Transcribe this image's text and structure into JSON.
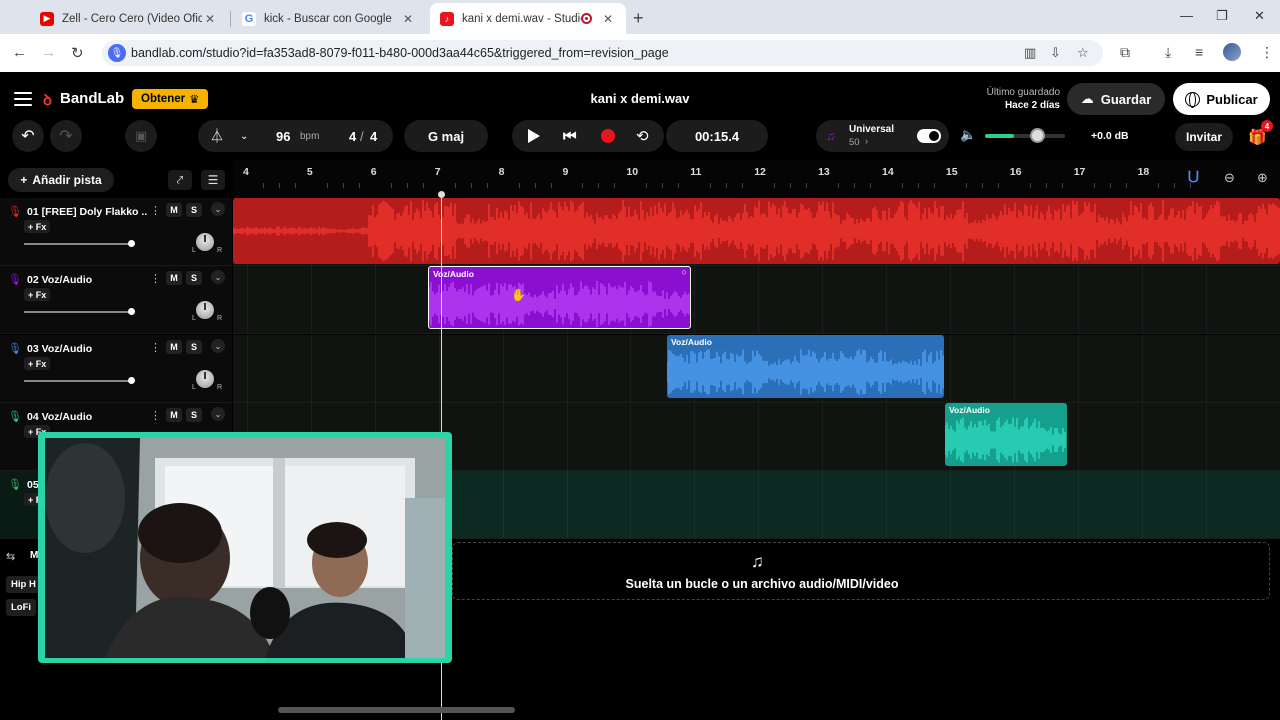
{
  "browser": {
    "tabs": [
      {
        "title": "Zell - Cero Cero (Video Oficial)"
      },
      {
        "title": "kick - Buscar con Google"
      },
      {
        "title": "kani x demi.wav - Studio"
      }
    ],
    "url": "bandlab.com/studio?id=fa353ad8-8079-f011-b480-000d3aa44c65&triggered_from=revision_page"
  },
  "app": {
    "brand": "BandLab",
    "obtener_label": "Obtener",
    "project_title": "kani x demi.wav",
    "last_saved_label": "Último guardado",
    "last_saved_value": "Hace 2 días",
    "save_label": "Guardar",
    "publish_label": "Publicar"
  },
  "transport": {
    "tempo": "96",
    "tempo_unit": "bpm",
    "time_sig_num": "4",
    "time_sig_den": "4",
    "key": "G maj",
    "time": "00:15.4",
    "tuner_label": "Universal",
    "tuner_value": "50",
    "volume_db": "+0.0 dB",
    "volume_level": 0.65,
    "invite_label": "Invitar",
    "notification_count": "4"
  },
  "tracks_panel": {
    "add_track_label": "Añadir pista",
    "mute_label": "M",
    "solo_label": "S",
    "fx_label": "+ Fx",
    "tracks": [
      {
        "number": "01",
        "name": "[FREE] Doly Flakko ...",
        "color": "#e52828"
      },
      {
        "number": "02",
        "name": "Voz/Audio",
        "color": "#9b11e6"
      },
      {
        "number": "03",
        "name": "Voz/Audio",
        "color": "#3a8de0"
      },
      {
        "number": "04",
        "name": "Voz/Audio",
        "color": "#1fc8b0"
      },
      {
        "number": "05",
        "name": "",
        "color": "#2bbf6a"
      }
    ],
    "partial_labels": {
      "track4_fx": "+ Fx",
      "track5_fx": "+ F",
      "master_label": "M"
    },
    "genre_tags": [
      "Hip H",
      "LoFi"
    ]
  },
  "timeline": {
    "bars": [
      "4",
      "5",
      "6",
      "7",
      "8",
      "9",
      "10",
      "11",
      "12",
      "13",
      "14",
      "15",
      "16",
      "17",
      "18"
    ],
    "clips": [
      {
        "label": "Voz/Audio",
        "track": 2,
        "color": "#9b11e6"
      },
      {
        "label": "Voz/Audio",
        "track": 3,
        "color": "#3a8de0"
      },
      {
        "label": "Voz/Audio",
        "track": 4,
        "color": "#1fc8b0"
      }
    ],
    "drop_text": "Suelta un bucle o un archivo audio/MIDI/video"
  }
}
